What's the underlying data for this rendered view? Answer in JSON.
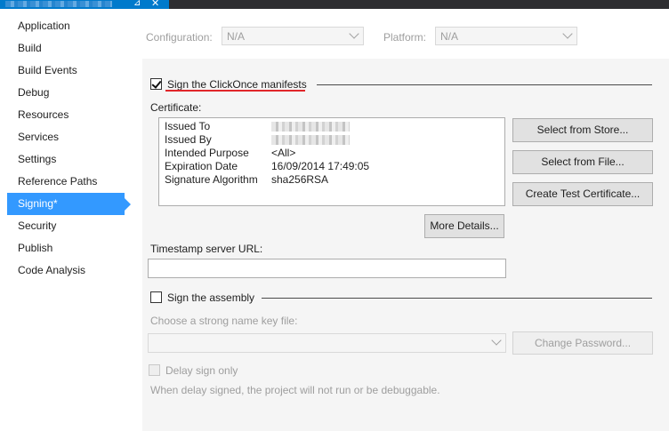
{
  "window": {
    "tab_pin_glyph": "⊿",
    "tab_close_glyph": "✕"
  },
  "sidebar": {
    "items": [
      {
        "label": "Application"
      },
      {
        "label": "Build"
      },
      {
        "label": "Build Events"
      },
      {
        "label": "Debug"
      },
      {
        "label": "Resources"
      },
      {
        "label": "Services"
      },
      {
        "label": "Settings"
      },
      {
        "label": "Reference Paths"
      },
      {
        "label": "Signing*",
        "active": true
      },
      {
        "label": "Security"
      },
      {
        "label": "Publish"
      },
      {
        "label": "Code Analysis"
      }
    ]
  },
  "config": {
    "configuration_label": "Configuration:",
    "configuration_value": "N/A",
    "platform_label": "Platform:",
    "platform_value": "N/A"
  },
  "signing": {
    "sign_manifests_label": "Sign the ClickOnce manifests",
    "sign_manifests_checked": true,
    "certificate_label": "Certificate:",
    "certificate": {
      "rows": [
        {
          "key": "Issued To",
          "value": ""
        },
        {
          "key": "Issued By",
          "value": ""
        },
        {
          "key": "Intended Purpose",
          "value": "<All>"
        },
        {
          "key": "Expiration Date",
          "value": "16/09/2014 17:49:05"
        },
        {
          "key": "Signature Algorithm",
          "value": "sha256RSA"
        }
      ]
    },
    "select_from_store_label": "Select from Store...",
    "select_from_file_label": "Select from File...",
    "create_test_cert_label": "Create Test Certificate...",
    "more_details_label": "More Details...",
    "timestamp_label": "Timestamp server URL:",
    "timestamp_value": "",
    "sign_assembly_label": "Sign the assembly",
    "sign_assembly_checked": false,
    "strong_name_label": "Choose a strong name key file:",
    "strong_name_value": "",
    "change_password_label": "Change Password...",
    "delay_sign_label": "Delay sign only",
    "delay_sign_note": "When delay signed, the project will not run or be debuggable."
  },
  "colors": {
    "accent": "#3399ff",
    "tab_blue": "#007acc",
    "highlight_underline": "#e0262a"
  }
}
